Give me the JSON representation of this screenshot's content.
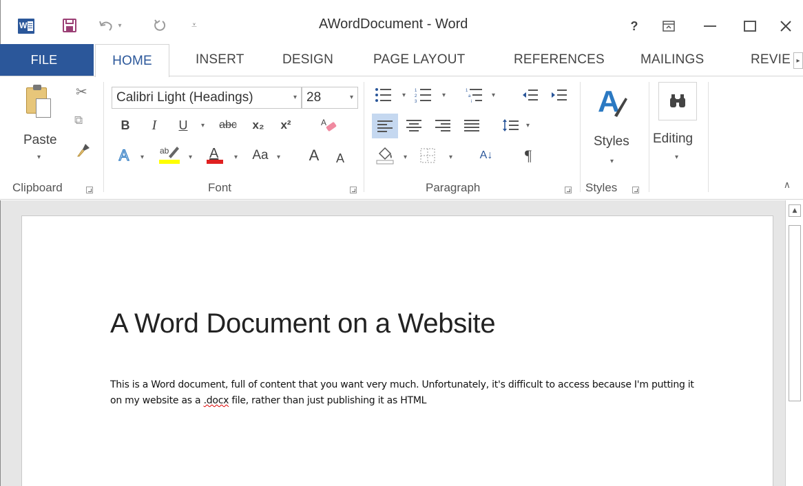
{
  "titlebar": {
    "title": "AWordDocument - Word",
    "help": "?",
    "restore_ribbon": "⊼",
    "minimize": "—",
    "maximize": "☐",
    "close": "✕"
  },
  "tabs": {
    "file": "FILE",
    "home": "HOME",
    "insert": "INSERT",
    "design": "DESIGN",
    "page_layout": "PAGE LAYOUT",
    "references": "REFERENCES",
    "mailings": "MAILINGS",
    "review": "REVIE",
    "scroll": "▸"
  },
  "ribbon": {
    "clipboard": {
      "label": "Clipboard",
      "paste": "Paste"
    },
    "font": {
      "label": "Font",
      "font_name": "Calibri Light (Headings)",
      "font_size": "28",
      "bold": "B",
      "italic": "I",
      "underline": "U",
      "strike": "abc",
      "subscript": "x₂",
      "superscript": "x²",
      "change_case": "Aa",
      "grow": "A",
      "shrink": "A"
    },
    "paragraph": {
      "label": "Paragraph",
      "pilcrow": "¶",
      "sort": "A↓"
    },
    "styles": {
      "label": "Styles",
      "button": "Styles"
    },
    "editing": {
      "button": "Editing"
    }
  },
  "document": {
    "heading": "A Word Document on a Website",
    "para_before": "This is a Word document, full of content that you want very much. Unfortunately, it's difficult to access because I'm putting it on my website as a ",
    "para_misspelled": ".docx",
    "para_after": " file, rather than just publishing it as HTML"
  },
  "colors": {
    "word_blue": "#2b579a",
    "highlight_yellow": "#ffff00",
    "font_color_red": "#e02020",
    "selected_align": "#c5d8f0"
  }
}
